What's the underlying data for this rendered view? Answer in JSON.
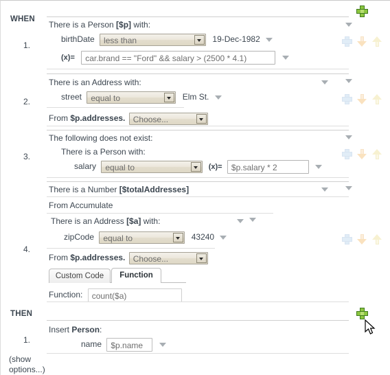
{
  "editor": {
    "when_label": "WHEN",
    "then_label": "THEN",
    "show_options_line1": "(show",
    "show_options_line2": "options...)",
    "colors": {
      "add_green": "#8cc63f",
      "add_green_border": "#3f7a1e",
      "text": "#3c4650",
      "field_border": "#a6a296",
      "triangle": "#a8aeb3"
    }
  },
  "when": {
    "add_button_label": "+",
    "patterns": [
      {
        "index": "1.",
        "title_prefix": "There is a Person ",
        "title_binding": "[$p]",
        "title_suffix": " with:",
        "constraints": [
          {
            "field": "birthDate",
            "operator": "less than",
            "value": "19-Dec-1982"
          }
        ],
        "expression": {
          "marker": "(x)=",
          "value": "car.brand == \"Ford\" && salary > (2500 * 4.1)"
        }
      },
      {
        "index": "2.",
        "title_prefix": "There is an Address with:",
        "title_binding": "",
        "title_suffix": "",
        "constraints": [
          {
            "field": "street",
            "operator": "equal to",
            "value": "Elm St."
          }
        ],
        "from": {
          "label": "From ",
          "source": "$p.addresses.",
          "choose": "Choose..."
        }
      },
      {
        "index": "3.",
        "not_exist_label": "The following does not exist:",
        "title_prefix": "There is a Person with:",
        "title_binding": "",
        "title_suffix": "",
        "constraints": [
          {
            "field": "salary",
            "operator": "equal to",
            "marker": "(x)=",
            "value": "$p.salary * 2"
          }
        ]
      },
      {
        "index": "4.",
        "title_prefix": "There is a Number ",
        "title_binding": "[$totalAddresses]",
        "title_suffix": "",
        "from_accumulate_label": "From Accumulate",
        "inner_title_prefix": "There is an Address ",
        "inner_title_binding": "[$a]",
        "inner_title_suffix": " with:",
        "constraints": [
          {
            "field": "zipCode",
            "operator": "equal to",
            "value": "43240"
          }
        ],
        "from": {
          "label": "From ",
          "source": "$p.addresses.",
          "choose": "Choose..."
        },
        "tabs": [
          {
            "label": "Custom Code",
            "active": false
          },
          {
            "label": "Function",
            "active": true
          }
        ],
        "function_label": "Function:",
        "function_value": "count($a)"
      }
    ]
  },
  "then": {
    "add_button_label": "+",
    "actions": [
      {
        "index": "1.",
        "verb": "Insert ",
        "target": "Person",
        "suffix": ":",
        "fields": [
          {
            "name": "name",
            "value": "$p.name"
          }
        ]
      }
    ]
  }
}
